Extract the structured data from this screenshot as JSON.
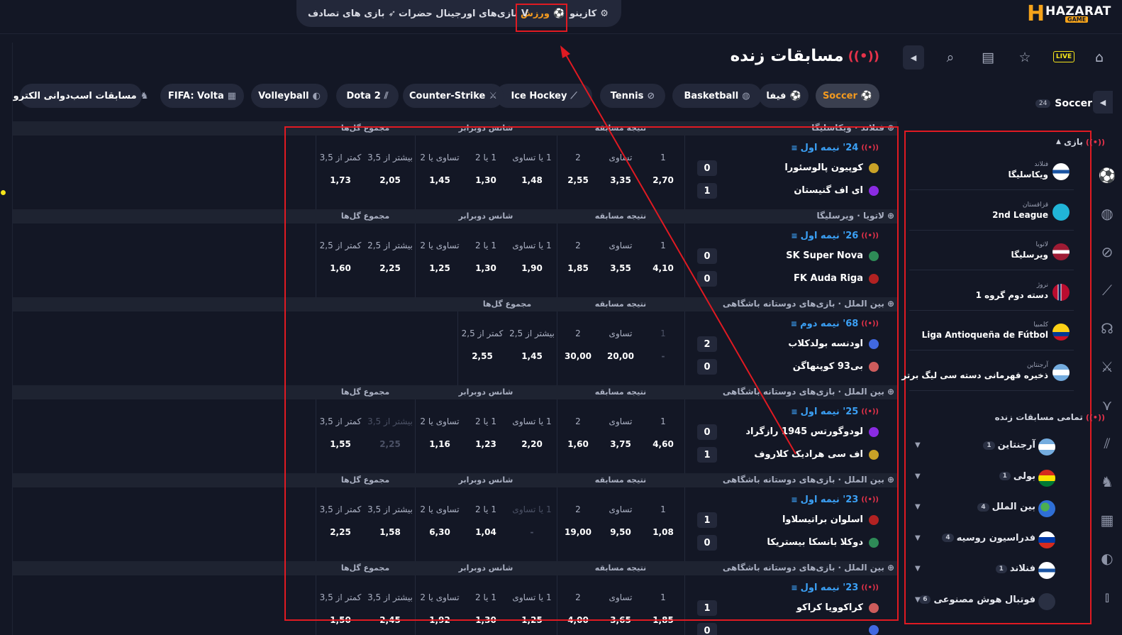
{
  "brand": {
    "logo_main": "HAZARAT",
    "logo_sub": "GAME",
    "logo_letter": "H"
  },
  "topnav": {
    "items": [
      {
        "label": "کازینو",
        "icon": "casino-chip-icon"
      },
      {
        "label": "ورزش",
        "icon": "soccer-ball-icon",
        "active": true
      },
      {
        "label": "بازی‌های اورجینال حضرات",
        "icon": "original-games-icon"
      },
      {
        "label": "بازی های تصادف",
        "icon": "rocket-icon"
      }
    ]
  },
  "header_icons": {
    "live_label": "LIVE"
  },
  "page": {
    "title": "مسابقات زنده"
  },
  "sport_tabs": [
    {
      "label": "Soccer",
      "icon": "soccer-ball-icon",
      "active": true
    },
    {
      "label": "فیفا",
      "icon": "fifa-icon"
    },
    {
      "label": "Basketball",
      "icon": "basketball-icon"
    },
    {
      "label": "Tennis",
      "icon": "tennis-icon"
    },
    {
      "label": "Ice Hockey",
      "icon": "hockey-icon"
    },
    {
      "label": "Counter-Strike",
      "icon": "cs-icon"
    },
    {
      "label": "Dota 2",
      "icon": "dota-icon"
    },
    {
      "label": "Volleyball",
      "icon": "volleyball-icon"
    },
    {
      "label": "FIFA: Volta",
      "icon": "fifa-volta-icon"
    },
    {
      "label": "مسابقات اسب‌دوانی الکترو",
      "icon": "horse-racing-icon"
    }
  ],
  "sidebar": {
    "sport_title": "Soccer",
    "sport_count": "24",
    "games_label": "بازی",
    "leagues": [
      {
        "country": "فنلاند",
        "name": "ویکاسلیگا",
        "flag": "fi"
      },
      {
        "country": "قزاقستان",
        "name": "2nd League",
        "flag": "kz"
      },
      {
        "country": "لاتویا",
        "name": "ویرسلیگا",
        "flag": "lv"
      },
      {
        "country": "نروژ",
        "name": "دسته دوم گروه 1",
        "flag": "no"
      },
      {
        "country": "کلمبیا",
        "name": "Liga Antioqueña de Fútbol",
        "flag": "co"
      },
      {
        "country": "آرجنتاین",
        "name": "ذخیره قهرمانی دسته سی لیگ برتر",
        "flag": "ar"
      }
    ],
    "all_live_label": "تمامی مسابقات زنده",
    "countries": [
      {
        "name": "آرجنتاین",
        "count": "1",
        "flag": "ar"
      },
      {
        "name": "بولی",
        "count": "1",
        "flag": "bo"
      },
      {
        "name": "بین الملل",
        "count": "4",
        "flag": "world"
      },
      {
        "name": "فدراسیون روسیه",
        "count": "4",
        "flag": "ru"
      },
      {
        "name": "فنلاند",
        "count": "1",
        "flag": "fi"
      },
      {
        "name": "فوتبال هوش مصنوعی",
        "count": "6",
        "flag": "ai"
      }
    ]
  },
  "market_groups": {
    "result": "نتیجه مسابقه",
    "double": "شانس دوبرابر",
    "total": "مجموع گل‌ها"
  },
  "matches": [
    {
      "league": "فنلاند · ویکاسلیگا",
      "time": "24' نیمه اول",
      "team1": "کوپیون پالوسئورا",
      "team2": "ای اف گنیستان",
      "score1": "0",
      "score2": "1",
      "odds": [
        {
          "label": "1",
          "value": "2,70"
        },
        {
          "label": "تساوی",
          "value": "3,35"
        },
        {
          "label": "2",
          "value": "2,55"
        },
        {
          "label": "1 یا تساوی",
          "value": "1,48"
        },
        {
          "label": "1 یا 2",
          "value": "1,30"
        },
        {
          "label": "تساوی یا 2",
          "value": "1,45"
        },
        {
          "label": "بیشتر از 3,5",
          "value": "2,05"
        },
        {
          "label": "کمتر از 3,5",
          "value": "1,73"
        }
      ]
    },
    {
      "league": "لاتویا · ویرسلیگا",
      "time": "26' نیمه اول",
      "team1": "SK Super Nova",
      "team2": "FK Auda Riga",
      "score1": "0",
      "score2": "0",
      "odds": [
        {
          "label": "1",
          "value": "4,10"
        },
        {
          "label": "تساوی",
          "value": "3,55"
        },
        {
          "label": "2",
          "value": "1,85"
        },
        {
          "label": "1 یا تساوی",
          "value": "1,90"
        },
        {
          "label": "1 یا 2",
          "value": "1,30"
        },
        {
          "label": "تساوی یا 2",
          "value": "1,25"
        },
        {
          "label": "بیشتر از 2,5",
          "value": "2,25"
        },
        {
          "label": "کمتر از 2,5",
          "value": "1,60"
        }
      ]
    },
    {
      "league": "بین الملل · بازی‌های دوستانه باشگاهی",
      "time": "68' نیمه دوم",
      "team1": "اودنسه بولدکلاب",
      "team2": "بی93 کوپنهاگن",
      "score1": "2",
      "score2": "0",
      "short": true,
      "odds": [
        {
          "label": "1",
          "value": "-",
          "dim": true
        },
        {
          "label": "تساوی",
          "value": "20,00"
        },
        {
          "label": "2",
          "value": "30,00"
        },
        {
          "label": "بیشتر از 2,5",
          "value": "1,45"
        },
        {
          "label": "کمتر از 2,5",
          "value": "2,55"
        }
      ]
    },
    {
      "league": "بین الملل · بازی‌های دوستانه باشگاهی",
      "time": "25' نیمه اول",
      "team1": "لودوگورتس 1945 رازگراد",
      "team2": "اف سی هرادیک کلاروف",
      "score1": "0",
      "score2": "1",
      "odds": [
        {
          "label": "1",
          "value": "4,60"
        },
        {
          "label": "تساوی",
          "value": "3,75"
        },
        {
          "label": "2",
          "value": "1,60"
        },
        {
          "label": "1 یا تساوی",
          "value": "2,20"
        },
        {
          "label": "1 یا 2",
          "value": "1,23"
        },
        {
          "label": "تساوی یا 2",
          "value": "1,16"
        },
        {
          "label": "بیشتر از 3,5",
          "value": "2,25",
          "dim": true
        },
        {
          "label": "کمتر از 3,5",
          "value": "1,55"
        }
      ]
    },
    {
      "league": "بین الملل · بازی‌های دوستانه باشگاهی",
      "time": "23' نیمه اول",
      "team1": "اسلوان براتیسلاوا",
      "team2": "دوکلا بانسکا بیستریکا",
      "score1": "1",
      "score2": "0",
      "odds": [
        {
          "label": "1",
          "value": "1,08"
        },
        {
          "label": "تساوی",
          "value": "9,50"
        },
        {
          "label": "2",
          "value": "19,00"
        },
        {
          "label": "1 یا تساوی",
          "value": "-",
          "dim": true
        },
        {
          "label": "1 یا 2",
          "value": "1,04"
        },
        {
          "label": "تساوی یا 2",
          "value": "6,30"
        },
        {
          "label": "بیشتر از 3,5",
          "value": "1,58"
        },
        {
          "label": "کمتر از 3,5",
          "value": "2,25"
        }
      ]
    },
    {
      "league": "بین الملل · بازی‌های دوستانه باشگاهی",
      "time": "23' نیمه اول",
      "team1": "کراکوویا کراکو",
      "team2": "",
      "score1": "1",
      "score2": "0",
      "odds": [
        {
          "label": "1",
          "value": "1,85"
        },
        {
          "label": "تساوی",
          "value": "3,65"
        },
        {
          "label": "2",
          "value": "4,00"
        },
        {
          "label": "1 یا تساوی",
          "value": "1,25"
        },
        {
          "label": "1 یا 2",
          "value": "1,30"
        },
        {
          "label": "تساوی یا 2",
          "value": "1,92"
        },
        {
          "label": "بیشتر از 3,5",
          "value": "2,45"
        },
        {
          "label": "کمتر از 3,5",
          "value": "1,50"
        }
      ]
    }
  ],
  "colors": {
    "accent": "#f39a1f",
    "live": "#e6324a",
    "time": "#3ba0f5",
    "annotation": "#e01a22",
    "background": "#131725"
  }
}
